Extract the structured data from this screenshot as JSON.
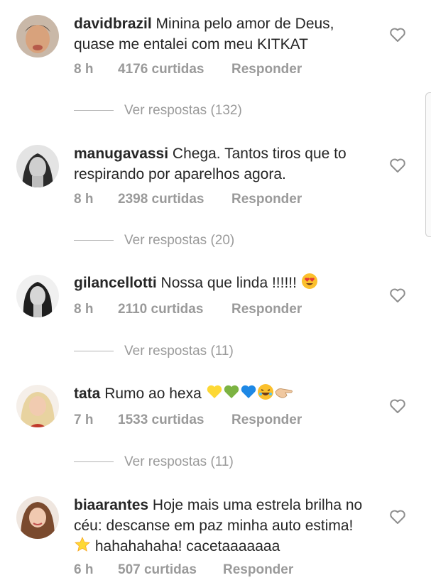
{
  "comments": [
    {
      "username": "davidbrazil",
      "text": "Minina pelo amor de Deus, quase me entalei com meu KITKAT",
      "time": "8 h",
      "likes": "4176 curtidas",
      "reply": "Responder",
      "view_replies": "Ver respostas (132)"
    },
    {
      "username": "manugavassi",
      "text": "Chega. Tantos tiros que to respirando por aparelhos agora.",
      "time": "8 h",
      "likes": "2398 curtidas",
      "reply": "Responder",
      "view_replies": "Ver respostas (20)"
    },
    {
      "username": "gilancellotti",
      "text": "Nossa que linda !!!!!! ",
      "time": "8 h",
      "likes": "2110 curtidas",
      "reply": "Responder",
      "view_replies": "Ver respostas (11)"
    },
    {
      "username": "tata",
      "text": "Rumo ao hexa ",
      "time": "7 h",
      "likes": "1533 curtidas",
      "reply": "Responder",
      "view_replies": "Ver respostas (11)"
    },
    {
      "username": "biaarantes",
      "text": "Hoje mais uma estrela brilha no céu: descanse em paz minha auto estima! ",
      "text_after_star": " hahahahaha! cacetaaaaaaa",
      "time": "6 h",
      "likes": "507 curtidas",
      "reply": "Responder"
    }
  ],
  "icons": {
    "like": "heart-outline-icon",
    "emoji_heart_eyes": "heart-eyes-emoji",
    "emoji_yellow_heart": "yellow-heart-emoji",
    "emoji_green_heart": "green-heart-emoji",
    "emoji_blue_heart": "blue-heart-emoji",
    "emoji_laughing": "laughing-emoji",
    "emoji_pointing": "pointing-hand-emoji",
    "emoji_star": "star-emoji"
  },
  "colors": {
    "text": "#262626",
    "muted": "#9a9a9a",
    "divider": "#b3b3b3"
  }
}
